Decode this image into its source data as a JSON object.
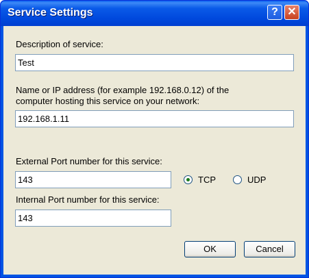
{
  "window": {
    "title": "Service Settings",
    "help_glyph": "?",
    "close_glyph": "✕"
  },
  "form": {
    "description_label": "Description of service:",
    "description_value": "Test",
    "host_label_line1": "Name or IP address (for example 192.168.0.12) of the",
    "host_label_line2": "computer hosting this service on your network:",
    "host_value": "192.168.1.11",
    "external_port_label": "External Port number for this service:",
    "external_port_value": "143",
    "internal_port_label": "Internal Port number for this service:",
    "internal_port_value": "143"
  },
  "protocol": {
    "options": [
      {
        "label": "TCP",
        "selected": true
      },
      {
        "label": "UDP",
        "selected": false
      }
    ]
  },
  "buttons": {
    "ok": "OK",
    "cancel": "Cancel"
  },
  "colors": {
    "title_bar": "#0054e3",
    "client_bg": "#ece9d8",
    "field_border": "#7f9db9"
  }
}
